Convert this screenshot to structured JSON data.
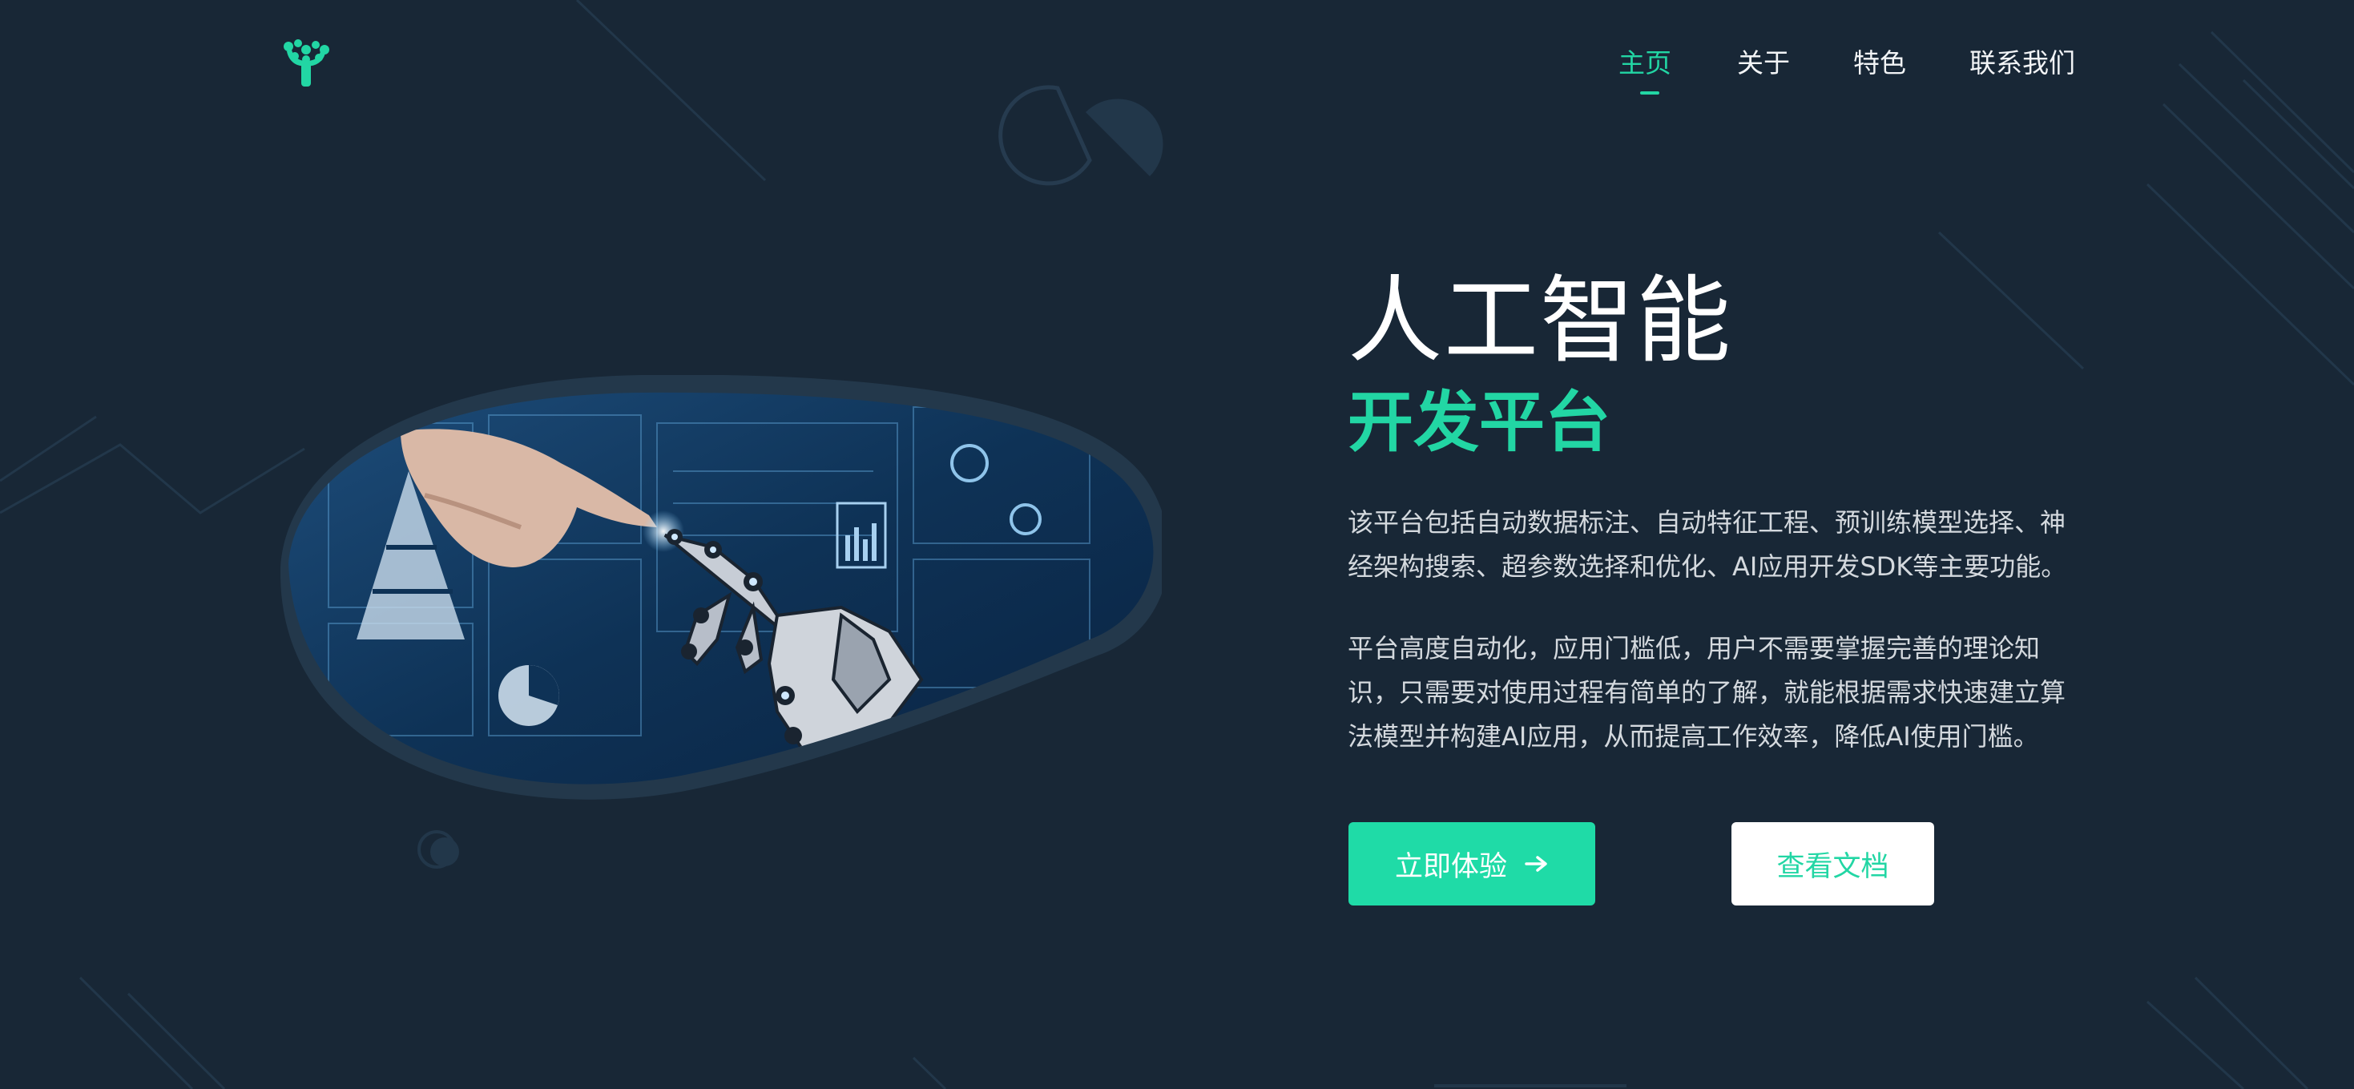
{
  "header": {
    "logo_icon": "coral-logo-icon",
    "nav": [
      {
        "label": "主页",
        "active": true
      },
      {
        "label": "关于",
        "active": false
      },
      {
        "label": "特色",
        "active": false
      },
      {
        "label": "联系我们",
        "active": false
      }
    ]
  },
  "hero": {
    "title": "人工智能",
    "subtitle": "开发平台",
    "paragraph1": "该平台包括自动数据标注、自动特征工程、预训练模型选择、神经架构搜索、超参数选择和优化、AI应用开发SDK等主要功能。",
    "paragraph2": "平台高度自动化，应用门槛低，用户不需要掌握完善的理论知识，只需要对使用过程有简单的了解，就能根据需求快速建立算法模型并构建AI应用，从而提高工作效率，降低AI使用门槛。",
    "primary_button": "立即体验",
    "primary_button_icon": "arrow-right-icon",
    "secondary_button": "查看文档",
    "image_icon": "robot-hand-touch-image"
  },
  "colors": {
    "background": "#182736",
    "accent": "#22d6a4",
    "text": "#ffffff",
    "muted_text": "#d4d9de"
  }
}
